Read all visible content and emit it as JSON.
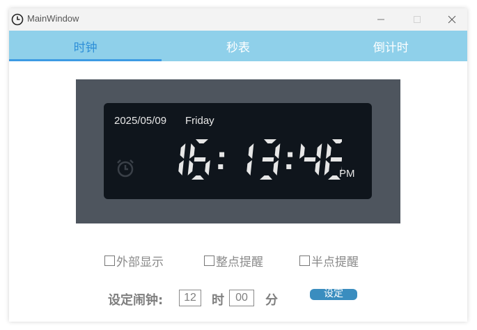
{
  "window": {
    "title": "MainWindow"
  },
  "tabs": [
    {
      "label": "时钟",
      "active": true
    },
    {
      "label": "秒表",
      "active": false
    },
    {
      "label": "倒计时",
      "active": false
    }
  ],
  "clock": {
    "date": "2025/05/09",
    "weekday": "Friday",
    "time": "16:13:46",
    "ampm": "PM",
    "colors": {
      "frame": "#4e555e",
      "panel": "#0f151c",
      "digits": "#e6e6e6",
      "alarm_icon": "#3a4048"
    }
  },
  "options": [
    {
      "label": "外部显示",
      "checked": false
    },
    {
      "label": "整点提醒",
      "checked": false
    },
    {
      "label": "半点提醒",
      "checked": false
    }
  ],
  "alarm": {
    "label": "设定闹钟:",
    "hour": "12",
    "hour_unit": "时",
    "minute": "00",
    "minute_unit": "分",
    "set_button": "设定"
  },
  "theme": {
    "tab_bar": "#8fd0ea",
    "tab_active_text": "#2e8fd8",
    "set_button": "#3a8dbf"
  }
}
